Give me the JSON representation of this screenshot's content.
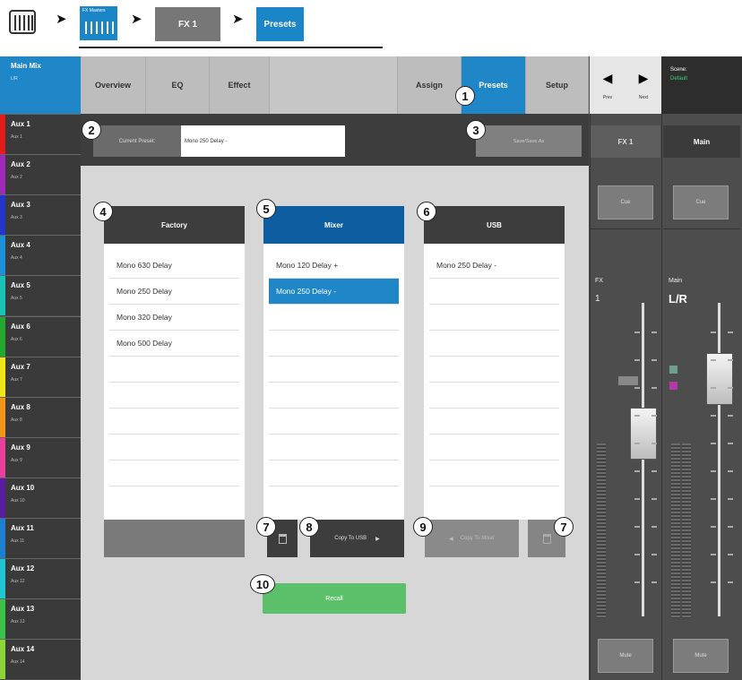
{
  "breadcrumb": {
    "fx_masters_label": "FX Masters",
    "fx1_label": "FX 1",
    "presets_label": "Presets",
    "arrow": "➤"
  },
  "channels": {
    "main": {
      "name": "Main Mix",
      "sub": "L/R"
    },
    "aux": [
      {
        "name": "Aux 1",
        "sub": "Aux 1",
        "color": "#e21b1b"
      },
      {
        "name": "Aux 2",
        "sub": "Aux 2",
        "color": "#a02ab8"
      },
      {
        "name": "Aux 3",
        "sub": "Aux 3",
        "color": "#2435c9"
      },
      {
        "name": "Aux 4",
        "sub": "Aux 4",
        "color": "#1d8fd8"
      },
      {
        "name": "Aux 5",
        "sub": "Aux 5",
        "color": "#18c2b5"
      },
      {
        "name": "Aux 6",
        "sub": "Aux 6",
        "color": "#24a832"
      },
      {
        "name": "Aux 7",
        "sub": "Aux 7",
        "color": "#efe517"
      },
      {
        "name": "Aux 8",
        "sub": "Aux 8",
        "color": "#f0961b"
      },
      {
        "name": "Aux 9",
        "sub": "Aux 9",
        "color": "#e8409a"
      },
      {
        "name": "Aux 10",
        "sub": "Aux 10",
        "color": "#5a1c9e"
      },
      {
        "name": "Aux 11",
        "sub": "Aux 11",
        "color": "#1e7fd2"
      },
      {
        "name": "Aux 12",
        "sub": "Aux 12",
        "color": "#22c6d2"
      },
      {
        "name": "Aux 13",
        "sub": "Aux 13",
        "color": "#3ac24a"
      },
      {
        "name": "Aux 14",
        "sub": "Aux 14",
        "color": "#8bd43a"
      }
    ]
  },
  "tabs": {
    "overview": "Overview",
    "eq": "EQ",
    "effect": "Effect",
    "assign": "Assign",
    "presets": "Presets",
    "setup": "Setup"
  },
  "nav": {
    "prev": "Prev",
    "next": "Next"
  },
  "scene": {
    "label": "Scene:",
    "value": "Default"
  },
  "preset_bar": {
    "current_label": "Current Preset:",
    "current_value": "Mono 250 Delay -",
    "save_label": "Save/Save As"
  },
  "columns": {
    "factory": {
      "title": "Factory",
      "items": [
        "Mono 630 Delay",
        "Mono 250 Delay",
        "Mono 320 Delay",
        "Mono 500 Delay"
      ]
    },
    "mixer": {
      "title": "Mixer",
      "items": [
        "Mono 120 Delay +",
        "Mono 250 Delay -"
      ]
    },
    "usb": {
      "title": "USB",
      "items": [
        "Mono 250 Delay -"
      ]
    }
  },
  "actions": {
    "copy_to_usb": "Copy To USB",
    "copy_to_mixer": "Copy To Mixer",
    "recall": "Recall",
    "right_arrow": "▶",
    "left_arrow": "◀"
  },
  "callouts": [
    "1",
    "2",
    "3",
    "4",
    "5",
    "6",
    "7",
    "8",
    "9",
    "7",
    "10"
  ],
  "strips": {
    "fx": {
      "title": "FX 1",
      "cue": "Cue",
      "name_line1": "FX",
      "name_line2": "1",
      "mute": "Mute"
    },
    "main": {
      "title": "Main",
      "cue": "Cue",
      "name_line1": "Main",
      "name_line2": "L/R",
      "mute": "Mute"
    }
  },
  "colors": {
    "accent_blue": "#1f86c7",
    "recall_green": "#5cc06a"
  }
}
